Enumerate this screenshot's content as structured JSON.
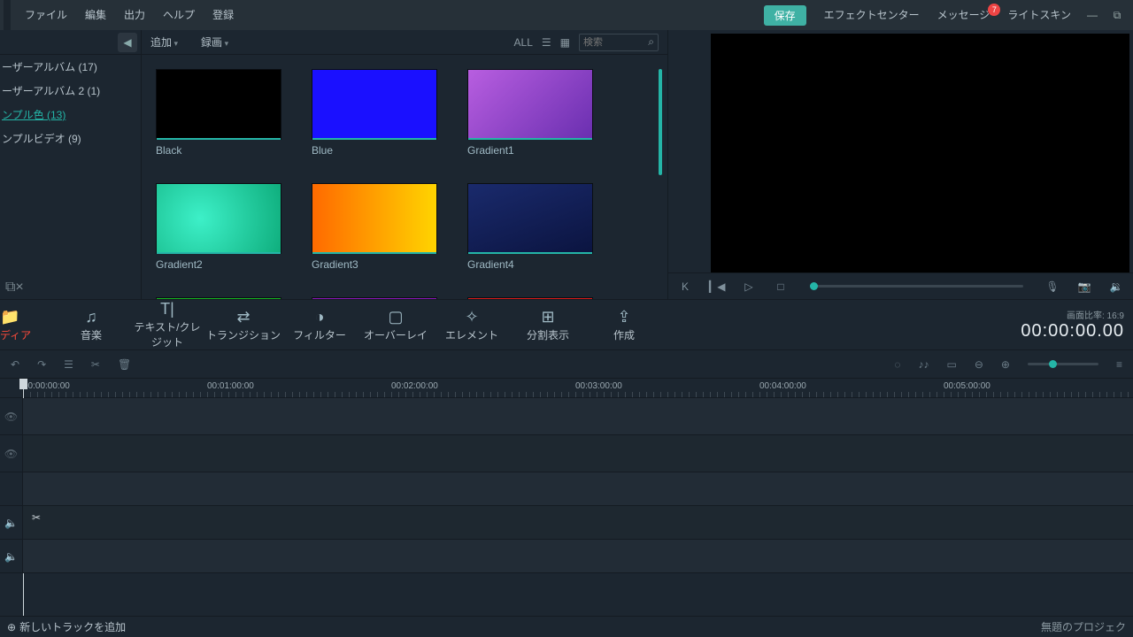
{
  "menu": {
    "file": "ファイル",
    "edit": "編集",
    "output": "出力",
    "help": "ヘルプ",
    "register": "登録",
    "save": "保存",
    "fxcenter": "エフェクトセンター",
    "message": "メッセージ",
    "msg_badge": "7",
    "lightskin": "ライトスキン"
  },
  "sidebar": {
    "items": [
      {
        "label": "ーザーアルバム (17)"
      },
      {
        "label": "ーザーアルバム 2 (1)"
      },
      {
        "label": "ンプル色  (13)",
        "selected": true
      },
      {
        "label": "ンプルビデオ  (9)"
      }
    ]
  },
  "browser": {
    "add": "追加",
    "record": "録画",
    "all": "ALL",
    "search_ph": "検索",
    "swatches": [
      {
        "label": "Black",
        "css": "background:#000"
      },
      {
        "label": "Blue",
        "css": "background:#1a10ff"
      },
      {
        "label": "Gradient1",
        "css": "background:linear-gradient(135deg,#b85ee0,#6a2fb0)"
      },
      {
        "label": "Gradient2",
        "css": "background:radial-gradient(circle at 35% 50%,#3df0c8,#0fae7d)"
      },
      {
        "label": "Gradient3",
        "css": "background:linear-gradient(90deg,#ff6a00,#ffd400)"
      },
      {
        "label": "Gradient4",
        "css": "background:linear-gradient(160deg,#1a2a6c,#0b1440)"
      },
      {
        "label": "",
        "css": "background:#15b321"
      },
      {
        "label": "",
        "css": "background:#8a17b8"
      },
      {
        "label": "",
        "css": "background:#d81b1b"
      }
    ]
  },
  "cats": [
    {
      "icon": "📁",
      "label": "ディア"
    },
    {
      "icon": "♫",
      "label": "音楽"
    },
    {
      "icon": "T|",
      "label": "テキスト/クレジット"
    },
    {
      "icon": "⇄",
      "label": "トランジション"
    },
    {
      "icon": "◑",
      "label": "フィルター"
    },
    {
      "icon": "▢",
      "label": "オーバーレイ"
    },
    {
      "icon": "✧",
      "label": "エレメント"
    },
    {
      "icon": "⊞",
      "label": "分割表示"
    },
    {
      "icon": "⇪",
      "label": "作成"
    }
  ],
  "aspect": "画面比率:  16:9",
  "timecode": "00:00:00.00",
  "ruler": [
    "00:00:00:00",
    "00:01:00:00",
    "00:02:00:00",
    "00:03:00:00",
    "00:04:00:00",
    "00:05:00:00"
  ],
  "footer": {
    "add": "新しいトラックを追加",
    "project": "無題のプロジェク"
  }
}
